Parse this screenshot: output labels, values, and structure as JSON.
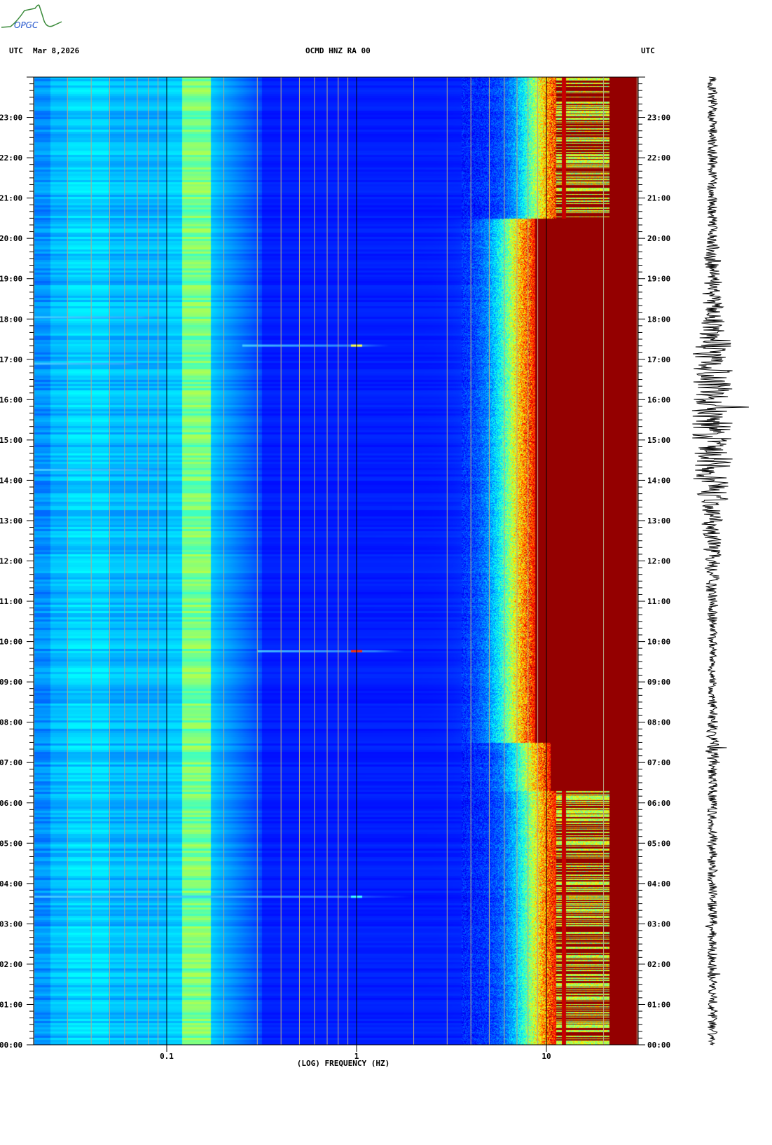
{
  "header": {
    "left_tz": "UTC",
    "date": "Mar 8,2026",
    "title": "OCMD HNZ RA 00",
    "right_tz": "UTC"
  },
  "logo": {
    "text": "OPGC"
  },
  "chart_data": {
    "type": "heatmap",
    "title": "OCMD HNZ RA 00",
    "subtitle": "Mar 8,2026",
    "xlabel": "(LOG) FREQUENCY (HZ)",
    "ylabel": "UTC",
    "x_scale": "log",
    "xlim_hz": [
      0.02,
      30
    ],
    "ylim_hours": [
      0,
      24
    ],
    "x_ticks": [
      {
        "value": 0.1,
        "label": "0.1"
      },
      {
        "value": 1,
        "label": "1"
      },
      {
        "value": 10,
        "label": "10"
      }
    ],
    "y_ticks": [
      "00:00",
      "01:00",
      "02:00",
      "03:00",
      "04:00",
      "05:00",
      "06:00",
      "07:00",
      "08:00",
      "09:00",
      "10:00",
      "11:00",
      "12:00",
      "13:00",
      "14:00",
      "15:00",
      "16:00",
      "17:00",
      "18:00",
      "19:00",
      "20:00",
      "21:00",
      "22:00",
      "23:00"
    ],
    "colormap": "jet",
    "microseism_band_hz": [
      0.12,
      0.17
    ],
    "high_noise_onset_hz": {
      "night": 9,
      "day": 6.5
    },
    "events": [
      {
        "time_h": 18.05,
        "f_min": 0.02,
        "f_max": 0.1
      },
      {
        "time_h": 17.35,
        "f_min": 0.25,
        "f_max": 1.5
      },
      {
        "time_h": 16.9,
        "f_min": 0.02,
        "f_max": 0.08
      },
      {
        "time_h": 14.27,
        "f_min": 0.02,
        "f_max": 0.1
      },
      {
        "time_h": 9.77,
        "f_min": 0.3,
        "f_max": 1.8
      },
      {
        "time_h": 3.68,
        "f_min": 0.02,
        "f_max": 2.0
      }
    ],
    "grid": true
  },
  "colors": {
    "dark_red": "#800000",
    "grid_minor": "#b8a888",
    "grid_major": "#000000"
  }
}
